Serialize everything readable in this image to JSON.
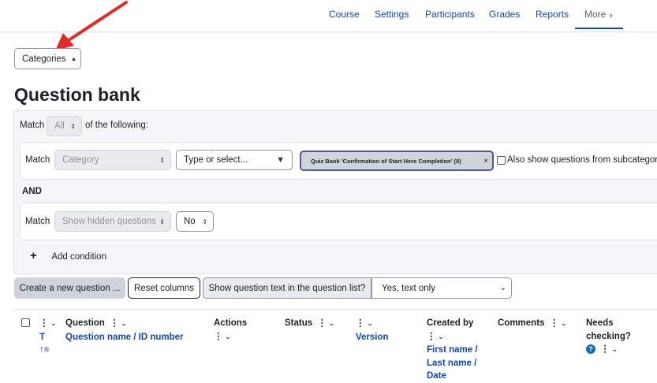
{
  "nav": {
    "items": [
      "Course",
      "Settings",
      "Participants",
      "Grades",
      "Reports"
    ],
    "more_label": "More"
  },
  "categories_button": "Categories",
  "page_title": "Question bank",
  "filter": {
    "match_label": "Match",
    "match_value": "All",
    "of_following": "of the following:",
    "cond1": {
      "match_label": "Match",
      "type": "Category",
      "type_or_select_placeholder": "Type or select...",
      "chip": "Quiz Bank 'Confirmation of Start Here Completion' (8)",
      "also_show": "Also show questions from subcategories"
    },
    "and_label": "AND",
    "cond2": {
      "match_label": "Match",
      "type": "Show hidden questions",
      "value": "No"
    },
    "add_condition": "Add condition"
  },
  "actions": {
    "create": "Create a new question ...",
    "reset": "Reset columns",
    "show_text_label": "Show question text in the question list?",
    "show_text_value": "Yes, text only"
  },
  "table": {
    "col_t": "T",
    "col_question": "Question",
    "col_question_sub": "Question name / ID number",
    "col_actions": "Actions",
    "col_status": "Status",
    "col_version": "Version",
    "col_created_by": "Created by",
    "col_created_sub1": "First name /",
    "col_created_sub2": "Last name /",
    "col_created_sub3": "Date",
    "col_comments": "Comments",
    "col_needs1": "Needs",
    "col_needs2": "checking?"
  },
  "colors": {
    "link": "#0f47ad",
    "arrow": "#e02b27",
    "chip_border": "#4d5b9e"
  },
  "icons": [
    "kebab-icon",
    "chevron-down-icon",
    "sort-asc-icon",
    "help-icon",
    "close-icon",
    "plus-icon",
    "red-arrow-annotation"
  ]
}
